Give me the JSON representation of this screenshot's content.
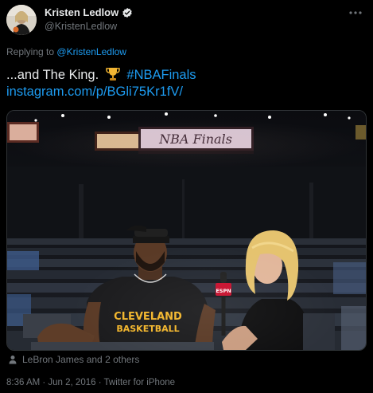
{
  "tweet": {
    "author_name": "Kristen Ledlow",
    "author_handle": "@KristenLedlow",
    "verified_icon": "verified-badge-icon",
    "more_icon": "more-options-icon",
    "reply_prefix": "Replying to",
    "reply_handle": "@KristenLedlow",
    "text_prefix": "...and The King.",
    "emoji_icon": "trophy-icon",
    "hashtag": "#NBAFinals",
    "link_text": "instagram.com/p/BGli75Kr1fV/",
    "media": {
      "scoreboard_text": "NBA Finals",
      "jersey_line1": "CLEVELAND",
      "jersey_line2": "BASKETBALL",
      "mic_flag": "ESPN"
    },
    "tagged_text": "LeBron James and 2 others",
    "timestamp": "8:36 AM · Jun 2, 2016",
    "separator": " · ",
    "source": "Twitter for iPhone"
  },
  "colors": {
    "background": "#000000",
    "text": "#e7e9ea",
    "muted": "#71767b",
    "accent": "#1d9bf0"
  }
}
